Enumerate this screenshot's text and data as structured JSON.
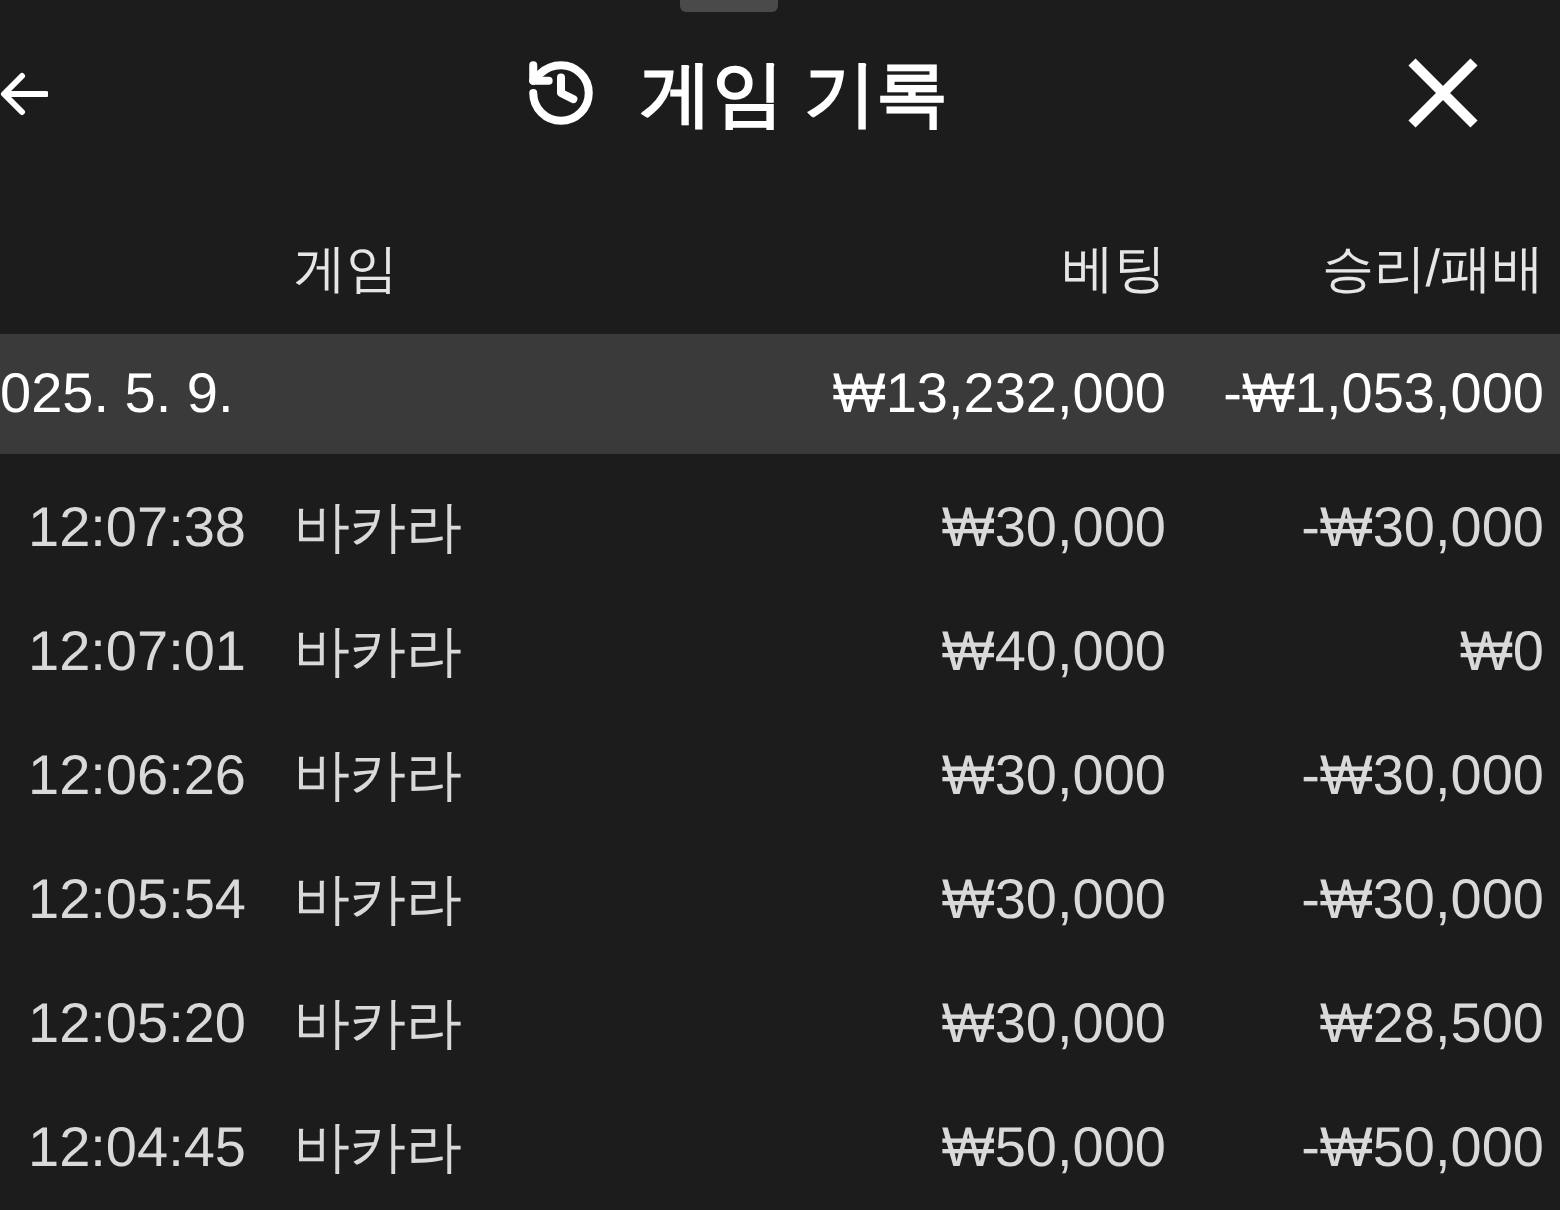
{
  "sheet": {
    "title": "게임 기록"
  },
  "table": {
    "columns": [
      "게임",
      "베팅",
      "승리/패배"
    ],
    "groups": [
      {
        "date": "025. 5. 9.",
        "bet": "₩13,232,000",
        "result": "-₩1,053,000",
        "rows": [
          {
            "time": "12:07:38",
            "game": "바카라",
            "bet": "₩30,000",
            "result": "-₩30,000"
          },
          {
            "time": "12:07:01",
            "game": "바카라",
            "bet": "₩40,000",
            "result": "₩0"
          },
          {
            "time": "12:06:26",
            "game": "바카라",
            "bet": "₩30,000",
            "result": "-₩30,000"
          },
          {
            "time": "12:05:54",
            "game": "바카라",
            "bet": "₩30,000",
            "result": "-₩30,000"
          },
          {
            "time": "12:05:20",
            "game": "바카라",
            "bet": "₩30,000",
            "result": "₩28,500"
          },
          {
            "time": "12:04:45",
            "game": "바카라",
            "bet": "₩50,000",
            "result": "-₩50,000"
          }
        ]
      }
    ]
  }
}
